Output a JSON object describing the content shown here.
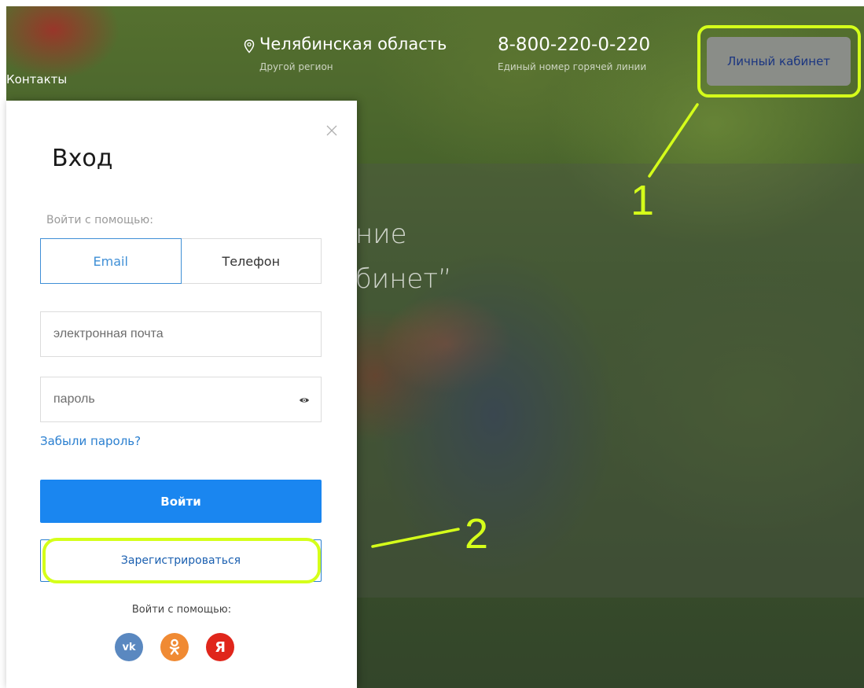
{
  "header": {
    "contacts_link": "Контакты",
    "region": "Челябинская область",
    "region_change": "Другой регион",
    "phone": "8-800-220-0-220",
    "phone_caption": "Единый номер горячей линии",
    "cabinet_button": "Личный кабинет"
  },
  "hero": {
    "line1": "ние",
    "line2": "бинет”"
  },
  "login_modal": {
    "title": "Вход",
    "login_with_label": "Войти с помощью:",
    "tabs": [
      {
        "label": "Email",
        "active": true
      },
      {
        "label": "Телефон",
        "active": false
      }
    ],
    "email_placeholder": "электронная почта",
    "password_placeholder": "пароль",
    "forgot_link": "Забыли пароль?",
    "login_button": "Войти",
    "register_button": "Зарегистрироваться",
    "social_label": "Войти с помощью:",
    "social": [
      {
        "name": "vk",
        "glyph": "vk",
        "color": "#5a88c0"
      },
      {
        "name": "odnoklassniki",
        "glyph": "ok",
        "color": "#f08a33"
      },
      {
        "name": "yandex",
        "glyph": "Я",
        "color": "#e0261b"
      }
    ]
  },
  "annotations": {
    "callout_1": "1",
    "callout_2": "2",
    "highlight_color": "#d5ff1a"
  }
}
